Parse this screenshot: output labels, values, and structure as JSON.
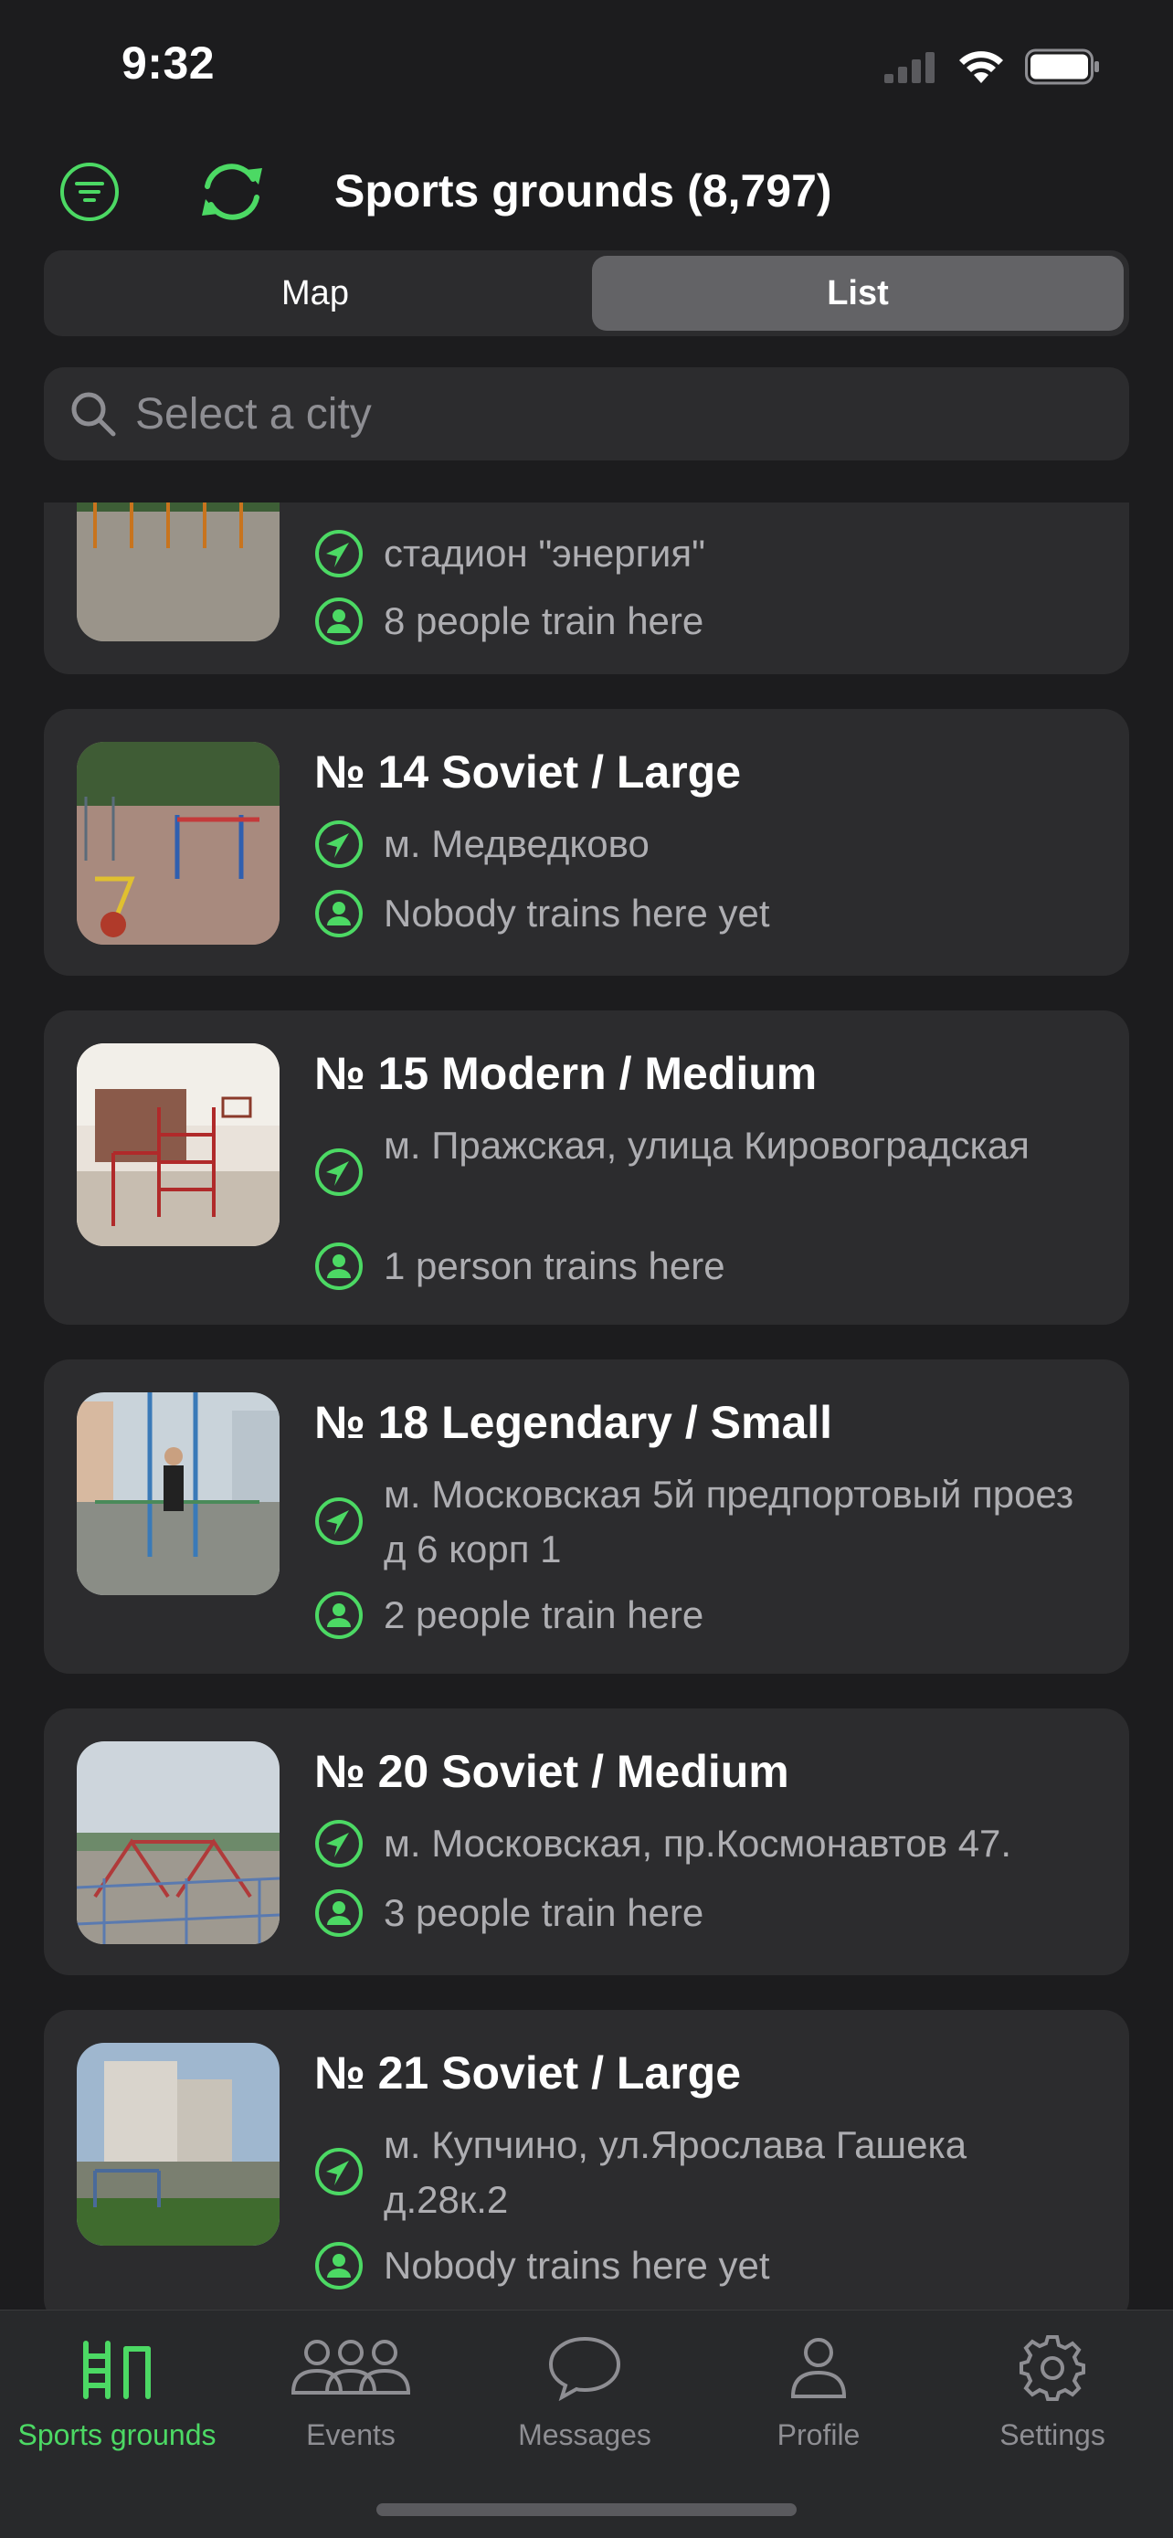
{
  "status_bar": {
    "time": "9:32"
  },
  "header": {
    "title": "Sports grounds (8,797)",
    "filter_icon": "filter-icon",
    "refresh_icon": "refresh-icon"
  },
  "segmented": {
    "map": "Map",
    "list": "List",
    "selected": "List"
  },
  "search": {
    "placeholder": "Select a city",
    "value": ""
  },
  "colors": {
    "accent": "#4cd964",
    "background": "#1c1c1e",
    "card": "#2c2c2e",
    "secondary_text": "#aeaeb2"
  },
  "grounds": [
    {
      "title": "",
      "address": "стадион \"энергия\"",
      "trainees": "8 people train here"
    },
    {
      "title": "№ 14 Soviet / Large",
      "address": "м. Медведково",
      "trainees": "Nobody trains here yet"
    },
    {
      "title": "№ 15 Modern / Medium",
      "address": "м. Пражская, улица Кировоградская",
      "trainees": "1 person trains here"
    },
    {
      "title": "№ 18 Legendary / Small",
      "address": "м. Московская 5й предпортовый проез д 6 корп 1",
      "trainees": "2 people train here"
    },
    {
      "title": "№ 20 Soviet / Medium",
      "address": "м. Московская,  пр.Космонавтов 47.",
      "trainees": "3 people train here"
    },
    {
      "title": "№ 21 Soviet / Large",
      "address": "м. Купчино, ул.Ярослава Гашека д.28к.2",
      "trainees": "Nobody trains here yet"
    }
  ],
  "tabs": [
    {
      "label": "Sports grounds",
      "icon": "bars-icon",
      "active": true
    },
    {
      "label": "Events",
      "icon": "people-icon",
      "active": false
    },
    {
      "label": "Messages",
      "icon": "chat-bubble-icon",
      "active": false
    },
    {
      "label": "Profile",
      "icon": "person-icon",
      "active": false
    },
    {
      "label": "Settings",
      "icon": "gear-icon",
      "active": false
    }
  ]
}
